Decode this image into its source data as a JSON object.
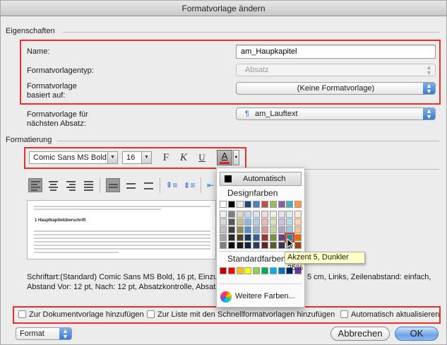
{
  "window": {
    "title": "Formatvorlage ändern"
  },
  "properties": {
    "section_label": "Eigenschaften",
    "name_label": "Name:",
    "name_value": "am_Haupkapitel",
    "type_label": "Formatvorlagentyp:",
    "type_value": "Absatz",
    "based_on_label_1": "Formatvorlage",
    "based_on_label_2": "basiert auf:",
    "based_on_value": "(Keine Formatvorlage)",
    "next_label_1": "Formatvorlage für",
    "next_label_2": "nächsten Absatz:",
    "next_value": "am_Lauftext",
    "next_icon": "paragraph-mark-icon"
  },
  "formatting": {
    "section_label": "Formatierung",
    "font": "Comic Sans MS Bold",
    "size": "16",
    "bold_label": "F",
    "italic_label": "K",
    "underline_label": "U",
    "font_color_label": "A",
    "font_color_underline": "#e02020"
  },
  "preview": {
    "heading": "1     Hauptkapitelüberschrift"
  },
  "color_menu": {
    "automatic_label": "Automatisch",
    "theme_colors_label": "Designfarben",
    "theme_top_row": [
      "#ffffff",
      "#000000",
      "#eeece1",
      "#1f497d",
      "#4f81bd",
      "#c0504d",
      "#9bbb59",
      "#8064a2",
      "#4bacc6",
      "#f79646"
    ],
    "theme_shade_columns": [
      [
        "#f2f2f2",
        "#d8d8d8",
        "#bfbfbf",
        "#a5a5a5",
        "#7f7f7f"
      ],
      [
        "#7f7f7f",
        "#595959",
        "#3f3f3f",
        "#262626",
        "#0c0c0c"
      ],
      [
        "#ddd9c3",
        "#c4bd97",
        "#938953",
        "#494429",
        "#1d1b10"
      ],
      [
        "#c6d9f0",
        "#8db3e2",
        "#548dd4",
        "#17365d",
        "#0f243e"
      ],
      [
        "#dbe5f1",
        "#b8cce4",
        "#95b3d7",
        "#366092",
        "#244061"
      ],
      [
        "#f2dcdb",
        "#e5b9b7",
        "#d99694",
        "#953734",
        "#632423"
      ],
      [
        "#ebf1dd",
        "#d7e3bc",
        "#c3d69b",
        "#76923c",
        "#4f6128"
      ],
      [
        "#e5e0ec",
        "#ccc1d9",
        "#b2a2c7",
        "#5f497a",
        "#3f3151"
      ],
      [
        "#dbeef3",
        "#b7dde8",
        "#92cddc",
        "#31859b",
        "#205867"
      ],
      [
        "#fdeada",
        "#fbd5b5",
        "#fac08f",
        "#e36c09",
        "#974806"
      ]
    ],
    "standard_colors_label": "Standardfarben",
    "standard_colors": [
      "#c00000",
      "#ff0000",
      "#ffc000",
      "#ffff00",
      "#92d050",
      "#00b050",
      "#00b0f0",
      "#0070c0",
      "#002060",
      "#7030a0"
    ],
    "more_colors_label": "Weitere Farben...",
    "tooltip": "Akzent 5, Dunkler 25%"
  },
  "description": {
    "line1_left": "Schriftart:(Standard) Comic Sans MS Bold, 16 pt, Einzug: L",
    "line1_right": "5 cm, Links, Zeilenabstand:  einfach,",
    "line2_left": "Abstand Vor:  12 pt, Nach:  12 pt, Absatzkontrolle, Absatz"
  },
  "options": {
    "add_to_template": "Zur Dokumentvorlage hinzufügen",
    "add_to_quick_styles": "Zur Liste mit den Schnellformatvorlagen hinzufügen",
    "auto_update": "Automatisch aktualisieren"
  },
  "footer": {
    "format_label": "Format",
    "cancel_label": "Abbrechen",
    "ok_label": "OK"
  }
}
